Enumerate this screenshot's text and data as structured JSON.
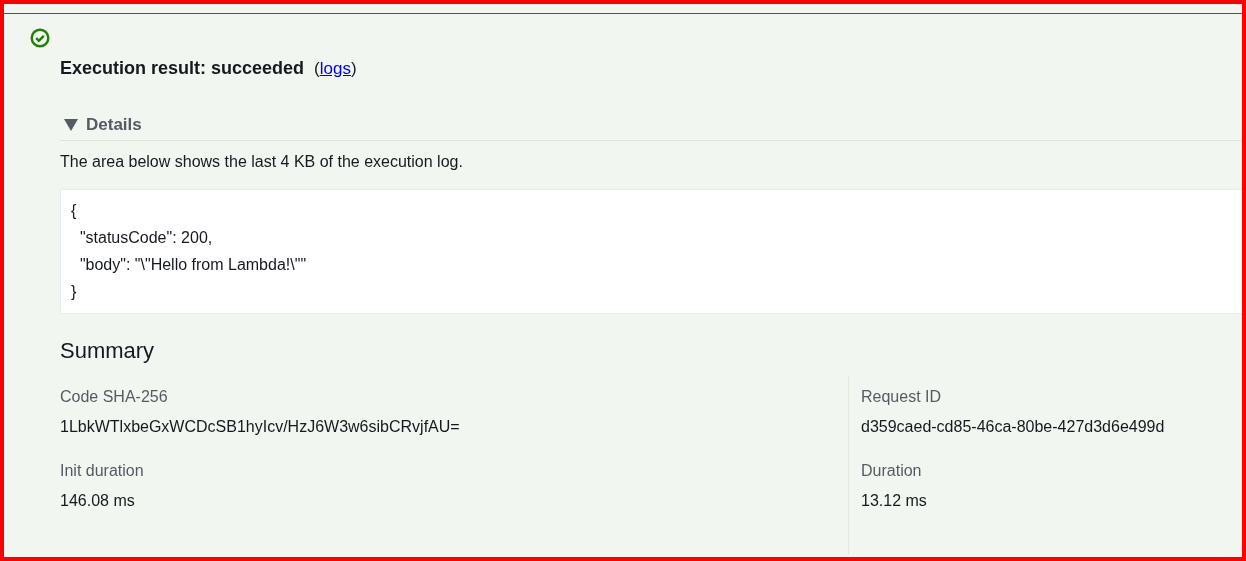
{
  "result": {
    "title": "Execution result: succeeded",
    "succeeded": true,
    "link_open": "(",
    "link": "logs",
    "link_close": ")"
  },
  "details": {
    "label": "Details",
    "expanded": true,
    "description": "The area below shows the last 4 KB of the execution log.",
    "log_lines": [
      "{",
      "  \"statusCode\": 200,",
      "  \"body\": \"\\\"Hello from Lambda!\\\"\"",
      "}"
    ]
  },
  "summary": {
    "title": "Summary",
    "columns": [
      {
        "fields": [
          {
            "label": "Code SHA-256",
            "value": "1LbkWTlxbeGxWCDcSB1hyIcv/HzJ6W3w6sibCRvjfAU="
          },
          {
            "label": "Init duration",
            "value": "146.08 ms"
          }
        ]
      },
      {
        "fields": [
          {
            "label": "Request ID",
            "value": "d359caed-cd85-46ca-80be-427d3d6e499d"
          },
          {
            "label": "Duration",
            "value": "13.12 ms"
          }
        ]
      }
    ]
  }
}
